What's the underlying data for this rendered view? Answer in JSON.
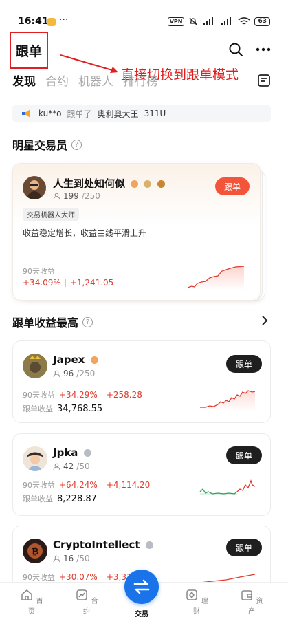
{
  "status_bar": {
    "time": "16:41",
    "dots": "···",
    "vpn": "VPN",
    "battery": "63"
  },
  "header": {
    "title": "跟单",
    "search_icon": "search-icon",
    "more_icon": "more-icon"
  },
  "annotation": {
    "text": "直接切换到跟单模式",
    "color": "#e02020"
  },
  "tabs": [
    {
      "label": "发现",
      "active": true
    },
    {
      "label": "合约",
      "active": false
    },
    {
      "label": "机器人",
      "active": false
    },
    {
      "label": "排行榜",
      "active": false
    }
  ],
  "notice": {
    "user": "ku**o",
    "action": "跟单了",
    "trader": "奥利奥大王",
    "amount": "311U"
  },
  "star_section": {
    "title": "明星交易员"
  },
  "star_trader": {
    "name": "人生到处知何似",
    "followers": "199",
    "followers_max": "/250",
    "tag": "交易机器人大师",
    "bio": "收益稳定增长，收益曲线平滑上升",
    "label_90d": "90天收益",
    "roi": "+34.09%",
    "pnl": "+1,241.05",
    "follow_label": "跟单"
  },
  "top_section": {
    "title": "跟单收益最高"
  },
  "traders": [
    {
      "name": "Japex",
      "followers": "96",
      "followers_max": "/250",
      "label_90d": "90天收益",
      "roi": "+34.29%",
      "pnl": "+258.28",
      "label_copy": "跟单收益",
      "copy_value": "34,768.55",
      "follow_label": "跟单"
    },
    {
      "name": "Jpka",
      "followers": "42",
      "followers_max": "/50",
      "label_90d": "90天收益",
      "roi": "+64.24%",
      "pnl": "+4,114.20",
      "label_copy": "跟单收益",
      "copy_value": "8,228.87",
      "follow_label": "跟单"
    },
    {
      "name": "CryptoIntellect",
      "followers": "16",
      "followers_max": "/50",
      "label_90d": "90天收益",
      "roi": "+30.07%",
      "pnl": "+3,31",
      "follow_label": "跟单"
    }
  ],
  "tabbar": {
    "items": [
      {
        "label": "首页",
        "icon": "home-icon"
      },
      {
        "label": "合约",
        "icon": "chart-icon"
      },
      {
        "label": "交易",
        "icon": "swap-icon",
        "active": true
      },
      {
        "label": "理财",
        "icon": "finance-icon"
      },
      {
        "label": "资产",
        "icon": "wallet-icon"
      }
    ]
  },
  "colors": {
    "accent": "#1a73e8",
    "profit": "#e03b2e",
    "follow_orange": "#f3553b",
    "annotation": "#e02020"
  }
}
